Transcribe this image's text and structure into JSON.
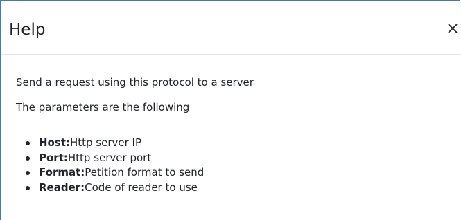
{
  "dialog": {
    "title": "Help",
    "close_label": "×"
  },
  "body": {
    "intro": "Send a request using this protocol to a server",
    "params_heading": "The parameters are the following",
    "params": [
      {
        "name": "Host:",
        "description": "Http server IP"
      },
      {
        "name": "Port:",
        "description": "Http server port"
      },
      {
        "name": "Format:",
        "description": "Petition format to send"
      },
      {
        "name": "Reader:",
        "description": "Code of reader to use"
      }
    ]
  },
  "colors": {
    "border_accent": "#4a78ad",
    "header_divider": "#e4e6e8",
    "text": "#212529"
  },
  "icons": {
    "close": "close-icon"
  }
}
